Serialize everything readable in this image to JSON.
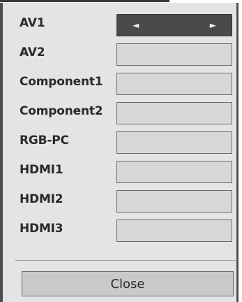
{
  "inputs": [
    {
      "label": "AV1",
      "selected": true,
      "left_arrow": "◄",
      "right_arrow": "►"
    },
    {
      "label": "AV2",
      "selected": false
    },
    {
      "label": "Component1",
      "selected": false
    },
    {
      "label": "Component2",
      "selected": false
    },
    {
      "label": "RGB-PC",
      "selected": false
    },
    {
      "label": "HDMI1",
      "selected": false
    },
    {
      "label": "HDMI2",
      "selected": false
    },
    {
      "label": "HDMI3",
      "selected": false
    }
  ],
  "close_label": "Close",
  "colors": {
    "dialog_bg": "#e4e4e4",
    "field_bg": "#d7d7d7",
    "selected_field_bg": "#4a4a4a",
    "text": "#2a2a2a"
  }
}
